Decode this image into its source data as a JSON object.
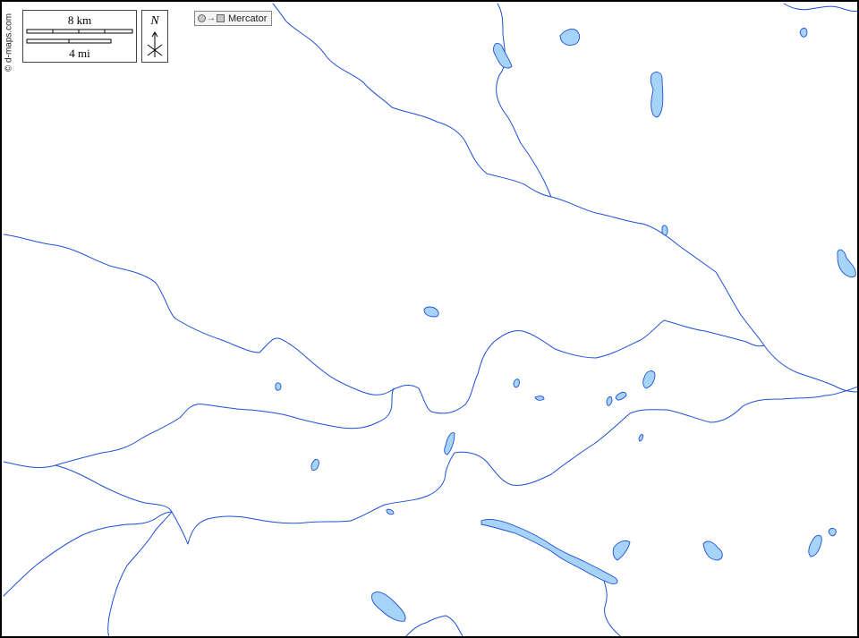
{
  "map": {
    "copyright": "© d-maps.com",
    "scale": {
      "km_label": "8 km",
      "mi_label": "4 mi"
    },
    "north_label": "N",
    "projection": {
      "label": "Mercator",
      "from_icon": "globe-circle-icon",
      "to_icon": "flat-square-icon"
    },
    "colors": {
      "water_fill": "#a6d4f8",
      "water_stroke": "#1e4fd6",
      "land": "#ffffff",
      "frame": "#000000"
    }
  }
}
